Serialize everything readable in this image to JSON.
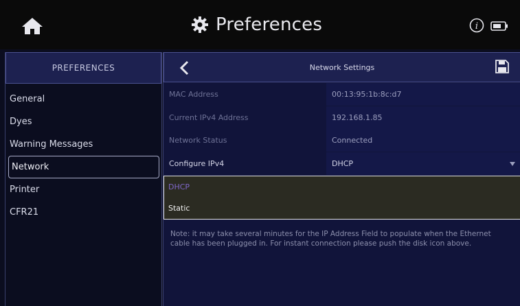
{
  "header": {
    "title": "Preferences",
    "icons": {
      "home": "home-icon",
      "gear": "gear-icon",
      "info": "info-icon",
      "battery": "battery-icon"
    }
  },
  "sidebar": {
    "header": "PREFERENCES",
    "items": [
      {
        "label": "General",
        "active": false
      },
      {
        "label": "Dyes",
        "active": false
      },
      {
        "label": "Warning Messages",
        "active": false
      },
      {
        "label": "Network",
        "active": true
      },
      {
        "label": "Printer",
        "active": false
      },
      {
        "label": "CFR21",
        "active": false
      }
    ]
  },
  "main": {
    "title": "Network Settings",
    "rows": [
      {
        "label": "MAC Address",
        "value": "00:13:95:1b:8c:d7"
      },
      {
        "label": "Current IPv4 Address",
        "value": "192.168.1.85"
      },
      {
        "label": "Network Status",
        "value": "Connected"
      },
      {
        "label": "Configure IPv4",
        "value": "DHCP"
      }
    ],
    "dropdown_options": [
      {
        "label": "DHCP",
        "selected": true
      },
      {
        "label": "Static",
        "selected": false
      }
    ],
    "note": "Note: it may take several minutes for the IP Address Field to populate when the Ethernet cable has been plugged in. For instant connection please push the disk icon above."
  },
  "colors": {
    "background": "#0b0d1f",
    "panel": "#11143a",
    "header_bar": "#1d2150",
    "selected_option": "#7f67c9",
    "dropdown_bg": "#2b2b22"
  }
}
